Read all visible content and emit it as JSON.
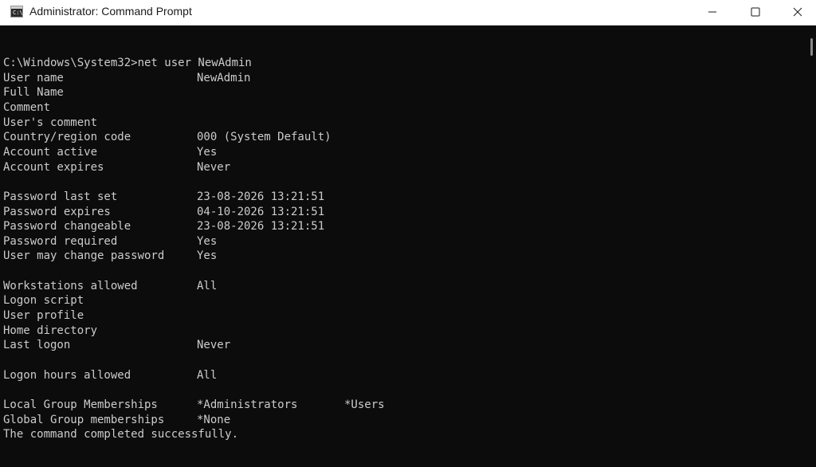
{
  "window": {
    "title": "Administrator: Command Prompt",
    "app_icon_text": "C:\\_"
  },
  "console": {
    "lines": [
      {
        "label": "C:\\Windows\\System32>net user NewAdmin",
        "value": ""
      },
      {
        "label": "User name",
        "value": "NewAdmin"
      },
      {
        "label": "Full Name",
        "value": ""
      },
      {
        "label": "Comment",
        "value": ""
      },
      {
        "label": "User's comment",
        "value": ""
      },
      {
        "label": "Country/region code",
        "value": "000 (System Default)"
      },
      {
        "label": "Account active",
        "value": "Yes"
      },
      {
        "label": "Account expires",
        "value": "Never"
      },
      {
        "label": "",
        "value": ""
      },
      {
        "label": "Password last set",
        "value": "23-08-2026 13:21:51"
      },
      {
        "label": "Password expires",
        "value": "04-10-2026 13:21:51"
      },
      {
        "label": "Password changeable",
        "value": "23-08-2026 13:21:51"
      },
      {
        "label": "Password required",
        "value": "Yes"
      },
      {
        "label": "User may change password",
        "value": "Yes"
      },
      {
        "label": "",
        "value": ""
      },
      {
        "label": "Workstations allowed",
        "value": "All"
      },
      {
        "label": "Logon script",
        "value": ""
      },
      {
        "label": "User profile",
        "value": ""
      },
      {
        "label": "Home directory",
        "value": ""
      },
      {
        "label": "Last logon",
        "value": "Never"
      },
      {
        "label": "",
        "value": ""
      },
      {
        "label": "Logon hours allowed",
        "value": "All"
      },
      {
        "label": "",
        "value": ""
      },
      {
        "label": "Local Group Memberships",
        "value": "*Administrators",
        "value2": "*Users"
      },
      {
        "label": "Global Group memberships",
        "value": "*None"
      },
      {
        "label": "The command completed successfully.",
        "value": ""
      }
    ]
  },
  "colors": {
    "console_bg": "#0c0c0c",
    "console_text": "#cccccc",
    "titlebar_bg": "#ffffff"
  }
}
